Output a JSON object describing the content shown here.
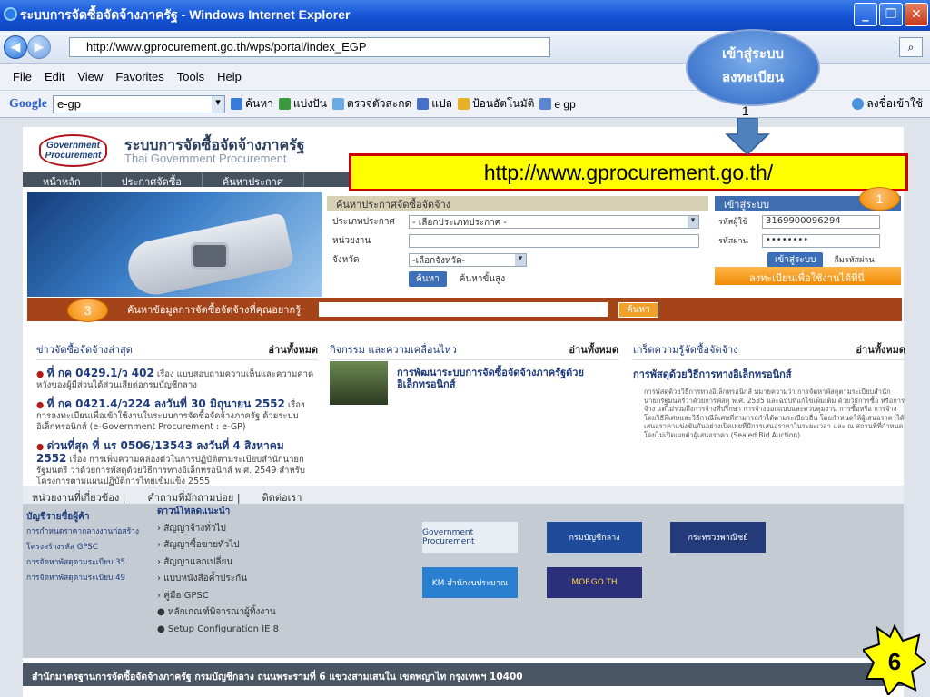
{
  "window": {
    "title": "ระบบการจัดซื้อจัดจ้างภาครัฐ - Windows Internet Explorer"
  },
  "address": {
    "url": "http://www.gprocurement.go.th/wps/portal/index_EGP",
    "search_icon": "search-icon"
  },
  "menu": [
    "File",
    "Edit",
    "View",
    "Favorites",
    "Tools",
    "Help"
  ],
  "toolbar": {
    "google_label": "Google",
    "google_query": "e-gp",
    "items": [
      "ค้นหา",
      "แบ่งปัน",
      "ตรวจตัวสะกด",
      "แปล",
      "ป้อนอัตโนมัติ",
      "e gp",
      "ลงชื่อเข้าใช้"
    ]
  },
  "site": {
    "logo_text": "Government Procurement",
    "title_th": "ระบบการจัดซื้อจัดจ้างภาครัฐ",
    "title_en": "Thai Government Procurement",
    "nav": [
      "หน้าหลัก",
      "ประกาศจัดซื้อ",
      "ค้นหาประกาศ"
    ],
    "search": {
      "heading": "ค้นหาประกาศจัดซื้อจัดจ้าง",
      "type_label": "ประเภทประกาศ",
      "type_value": "- เลือกประเภทประกาศ -",
      "agency_label": "หน่วยงาน",
      "province_label": "จังหวัด",
      "province_value": "-เลือกจังหวัด-",
      "search_btn": "ค้นหา",
      "advanced": "ค้นหาขั้นสูง"
    },
    "login": {
      "heading": "เข้าสู่ระบบ",
      "user_label": "รหัสผู้ใช้",
      "user_value": "3169900096294",
      "pass_label": "รหัสผ่าน",
      "pass_value": "••••••••",
      "login_btn": "เข้าสู่ระบบ",
      "forgot": "ลืมรหัสผ่าน",
      "register": "ลงทะเบียนเพื่อใช้งานได้ที่นี่"
    },
    "bar_search": {
      "label": "ค้นหาข้อมูลการจัดซื้อจัดจ้างที่คุณอยากรู้",
      "btn": "ค้นหา"
    },
    "news1": {
      "heading": "ข่าวจัดซื้อจัดจ้างล่าสุด",
      "more": "อ่านทั้งหมด",
      "items": [
        {
          "bold": "ที่ กค 0429.1/ว 402",
          "text": "เรื่อง แบบสอบถามความเห็นและความคาดหวังของผู้มีส่วนได้ส่วนเสียต่อกรมบัญชีกลาง"
        },
        {
          "bold": "ที่ กค 0421.4/ว224 ลงวันที่ 30 มิถุนายน 2552",
          "text": "เรื่อง การลงทะเบียนเพื่อเข้าใช้งานในระบบการจัดซื้อจัดจ้างภาครัฐ ด้วยระบบอิเล็กทรอนิกส์ (e-Government Procurement : e-GP)"
        },
        {
          "bold": "ด่วนที่สุด ที่ นร 0506/13543 ลงวันที่ 4 สิงหาคม 2552",
          "text": "เรื่อง การเพิ่มความคล่องตัวในการปฏิบัติตามระเบียบสำนักนายกรัฐมนตรี ว่าด้วยการพัสดุด้วยวิธีการทางอิเล็กทรอนิกส์ พ.ศ. 2549 สำหรับโครงการตามแผนปฏิบัติการไทยเข้มแข็ง 2555"
        }
      ]
    },
    "news2": {
      "heading": "กิจกรรม และความเคลื่อนไหว",
      "more": "อ่านทั้งหมด",
      "text": "การพัฒนาระบบการจัดซื้อจัดจ้างภาครัฐด้วยอิเล็กทรอนิกส์"
    },
    "news3": {
      "heading": "เกร็ดความรู้จัดซื้อจัดจ้าง",
      "more": "อ่านทั้งหมด",
      "title": "การพัสดุด้วยวิธีการทางอิเล็กทรอนิกส์",
      "body": "การพัสดุด้วยวิธีการทางอิเล็กทรอนิกส์ หมายความว่า การจัดหาพัสดุตามระเบียบสำนักนายกรัฐมนตรีว่าด้วยการพัสดุ พ.ศ. 2535 และฉบับที่แก้ไขเพิ่มเติม ด้วยวิธีการซื้อ หรือการจ้าง แต่ไม่รวมถึงการจ้างที่ปรึกษา การจ้างออกแบบและควบคุมงาน การซื้อหรือ การจ้างโดยวิธีพิเศษและวิธีกรณีพิเศษที่สามารถกำได้ตามระเบียบอื่น โดยกำหนดให้ผู้เสนอราคาได้เสนอราคาแข่งขันกันอย่างเปิดเผยที่มีการเสนอราคาในระยะเวลา และ ณ สถานที่ที่กำหนด โดยไม่เปิดเผยตัวผู้เสนอราคา (Sealed Bid Auction)"
    },
    "footer_links": [
      "หน่วยงานที่เกี่ยวข้อง |",
      "คำถามที่มักถามบ่อย |",
      "ติดต่อเรา"
    ],
    "left_links": {
      "heading": "บัญชีรายชื่อผู้ค้า",
      "items": [
        "การกำหนดราคากลางงานก่อสร้าง",
        "โครงสร้างรหัส GPSC",
        "การจัดหาพัสดุตามระเบียบ 35",
        "การจัดหาพัสดุตามระเบียบ 49"
      ]
    },
    "downloads": {
      "heading": "ดาวน์โหลดแนะนำ",
      "items": [
        "สัญญาจ้างทั่วไป",
        "สัญญาซื้อขายทั่วไป",
        "สัญญาแลกเปลี่ยน",
        "แบบหนังสือค้ำประกัน",
        "คู่มือ GPSC",
        "หลักเกณฑ์พิจารณาผู้ทิ้งงาน",
        "Setup Configuration IE 8"
      ]
    },
    "partners": [
      "Government Procurement",
      "กรมบัญชีกลาง",
      "กระทรวงพาณิชย์",
      "KM สำนักงบประมาณ",
      "MOF.GO.TH"
    ],
    "address": "สำนักมาตรฐานการจัดซื้อจัดจ้างภาครัฐ กรมบัญชีกลาง ถนนพระรามที่ 6 แขวงสามเสนใน เขตพญาไท กรุงเทพฯ 10400"
  },
  "annotations": {
    "url_callout": "http://www.gprocurement.go.th/",
    "bubble_line1": "เข้าสู่ระบบ",
    "bubble_line2": "ลงทะเบียน",
    "bubble_num": "1",
    "circle1": "1",
    "circle3": "3",
    "slide_number": "6"
  },
  "colors": {
    "ie_title": "#1554d6",
    "callout_fill": "#ffff00",
    "callout_border": "#cc0000",
    "orange": "#f08a00"
  }
}
